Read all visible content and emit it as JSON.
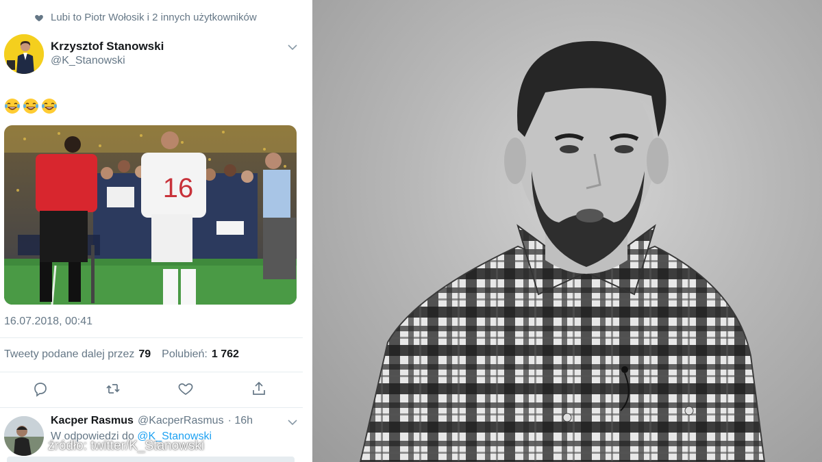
{
  "tweet": {
    "liked_by": "Lubi to Piotr Wołosik i 2 innych użytkowników",
    "author_name": "Krzysztof Stanowski",
    "author_handle": "@K_Stanowski",
    "emoji_text": "😂😂😂",
    "media_icon": "photo-world-cup-celebration",
    "timestamp": "16.07.2018, 00:41",
    "retweets_label": "Tweety podane dalej przez",
    "retweets_count": "79",
    "likes_label": "Polubień:",
    "likes_count": "1 762",
    "actions": [
      "reply-icon",
      "retweet-icon",
      "like-icon",
      "share-icon"
    ]
  },
  "reply": {
    "author_name": "Kacper Rasmus",
    "author_handle": "@KacperRasmus",
    "time": "· 16h",
    "reply_to_label": "W odpowiedzi do",
    "reply_to_handle": "@K_Stanowski"
  },
  "watermark": {
    "source": "źródło: twitter/K_Stanowski"
  },
  "colors": {
    "link": "#1da1f2",
    "secondary_text": "#657786",
    "divider": "#e6ecf0"
  }
}
